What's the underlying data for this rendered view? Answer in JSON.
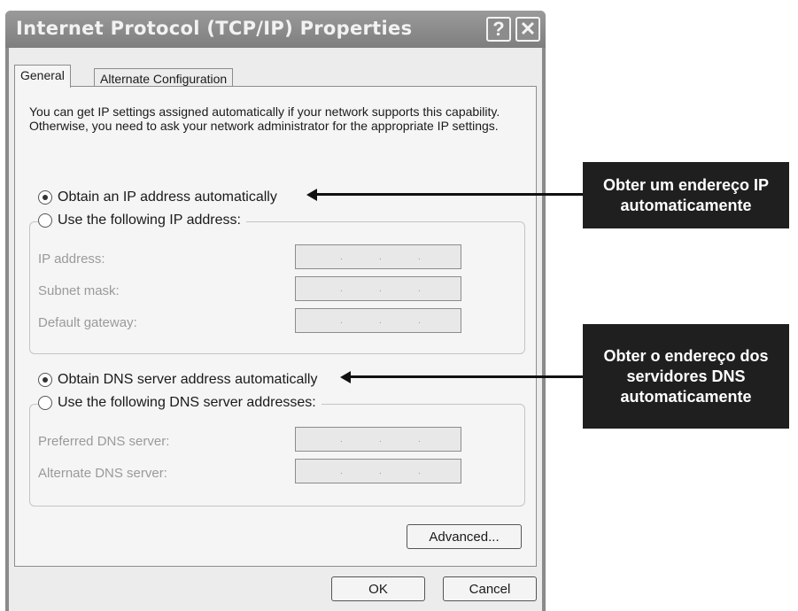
{
  "window": {
    "title": "Internet Protocol (TCP/IP) Properties",
    "help_glyph": "?",
    "close_glyph": "✕"
  },
  "tabs": [
    {
      "label": "General"
    },
    {
      "label": "Alternate Configuration"
    }
  ],
  "description": "You can get IP settings assigned automatically if your network supports this capability. Otherwise, you need to ask your network administrator for the appropriate IP settings.",
  "ip": {
    "auto_label": "Obtain an IP address automatically",
    "manual_label": "Use the following IP address:",
    "selected": "auto",
    "fields": [
      {
        "label": "IP address:"
      },
      {
        "label": "Subnet mask:"
      },
      {
        "label": "Default gateway:"
      }
    ]
  },
  "dns": {
    "auto_label": "Obtain DNS server address automatically",
    "manual_label": "Use the following DNS server addresses:",
    "selected": "auto",
    "fields": [
      {
        "label": "Preferred DNS server:"
      },
      {
        "label": "Alternate DNS server:"
      }
    ]
  },
  "buttons": {
    "advanced": "Advanced...",
    "ok": "OK",
    "cancel": "Cancel"
  },
  "callouts": {
    "ip": "Obter um endereço IP automaticamente",
    "dns": "Obter o endereço dos servidores DNS automaticamente"
  },
  "colors": {
    "titlebar": "#8a8a8a",
    "callout_bg": "#1f1f1f",
    "callout_text": "#ffffff"
  }
}
